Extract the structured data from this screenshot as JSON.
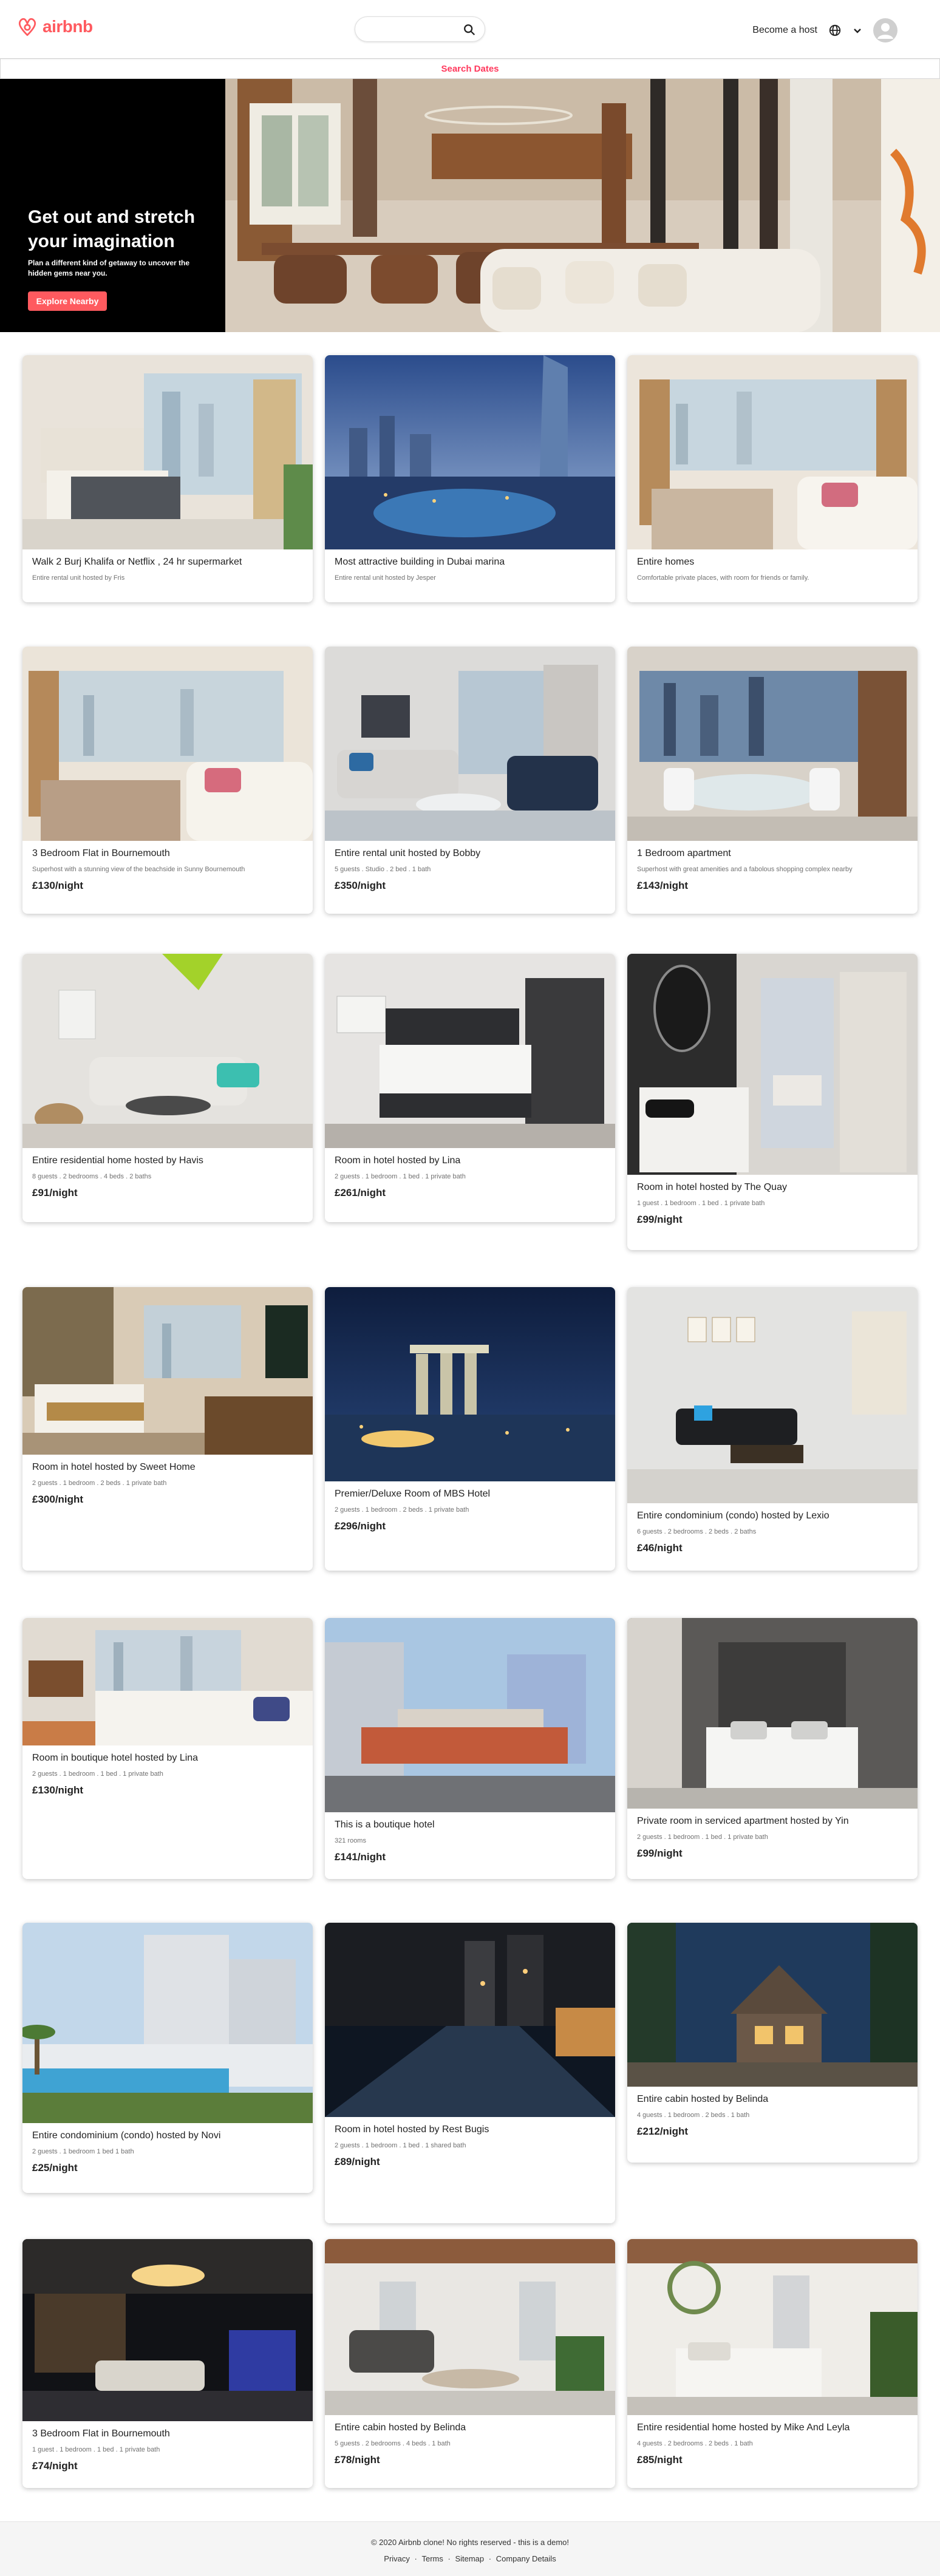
{
  "header": {
    "logo_text": "airbnb",
    "search_placeholder": "",
    "become_host": "Become a host",
    "icons": [
      "airbnb-logo-icon",
      "search-icon",
      "globe-icon",
      "chevron-down-icon",
      "user-avatar-icon"
    ]
  },
  "search_dates": "Search Dates",
  "banner": {
    "title": "Get out and stretch your imagination",
    "subtitle": "Plan a different kind of getaway to uncover the hidden gems near you.",
    "cta": "Explore Nearby"
  },
  "colors": {
    "brand": "#ff5a5f",
    "dates": "#ff385c"
  },
  "listings": [
    {
      "title": "Walk 2 Burj Khalifa or Netflix , 24 hr supermarket",
      "desc": "Entire rental unit hosted by Fris",
      "price": "",
      "photo": "bedroom-city"
    },
    {
      "title": "Most attractive building in Dubai marina",
      "desc": "Entire rental unit hosted by Jesper",
      "price": "",
      "photo": "marina-night"
    },
    {
      "title": "Entire homes",
      "desc": "Comfortable private places, with room for friends or family.",
      "price": "",
      "photo": "living-window"
    },
    {
      "title": "3 Bedroom Flat in Bournemouth",
      "desc": "Superhost with a stunning view of the beachside in Sunny Bournemouth",
      "price": "£130/night",
      "photo": "living-window"
    },
    {
      "title": "Entire rental unit hosted by Bobby",
      "desc": "5 guests . Studio . 2 bed . 1 bath",
      "price": "£350/night",
      "photo": "living-modern"
    },
    {
      "title": "1 Bedroom apartment",
      "desc": "Superhost with great amenities and a fabolous shopping complex nearby",
      "price": "£143/night",
      "photo": "dining-view"
    },
    {
      "title": "Entire residential home hosted by Havis",
      "desc": "8 guests . 2 bedrooms . 4 beds . 2 baths",
      "price": "£91/night",
      "photo": "lounge-green"
    },
    {
      "title": "Room in hotel hosted by Lina",
      "desc": "2 guests . 1 bedroom . 1 bed . 1 private bath",
      "price": "£261/night",
      "photo": "hotel-room"
    },
    {
      "title": "Room in hotel hosted by The Quay",
      "desc": "1 guest . 1 bedroom . 1 bed . 1 private bath",
      "price": "£99/night",
      "photo": "bathroom"
    },
    {
      "title": "Room in hotel hosted by Sweet Home",
      "desc": "2 guests . 1 bedroom . 2 beds . 1 private bath",
      "price": "£300/night",
      "photo": "hotel-suite"
    },
    {
      "title": "Premier/Deluxe Room of MBS Hotel",
      "desc": "2 guests . 1 bedroom . 2 beds . 1 private bath",
      "price": "£296/night",
      "photo": "mbs-night"
    },
    {
      "title": "Entire condominium (condo) hosted by Lexio",
      "desc": "6 guests . 2 bedrooms . 2 beds . 2 baths",
      "price": "£46/night",
      "photo": "condo-living"
    },
    {
      "title": "Room in boutique hotel hosted by Lina",
      "desc": "2 guests . 1 bedroom . 1 bed . 1 private bath",
      "price": "£130/night",
      "photo": "boutique-room"
    },
    {
      "title": "This is a boutique hotel",
      "desc": "321 rooms",
      "price": "£141/night",
      "photo": "hotel-exterior"
    },
    {
      "title": "Private room in serviced apartment hosted by Yin",
      "desc": "2 guests . 1 bedroom . 1 bed . 1 private bath",
      "price": "£99/night",
      "photo": "dark-bedroom"
    },
    {
      "title": "Entire condominium (condo) hosted by Novi",
      "desc": "2 guests . 1 bedroom 1 bed 1 bath",
      "price": "£25/night",
      "photo": "condo-pool"
    },
    {
      "title": "Room in hotel hosted by Rest Bugis",
      "desc": "2 guests . 1 bedroom . 1 bed . 1 shared bath",
      "price": "£89/night",
      "photo": "night-pool"
    },
    {
      "title": "Entire cabin hosted by Belinda",
      "desc": "4 guests . 1 bedroom . 2 beds . 1 bath",
      "price": "£212/night",
      "photo": "cabin-night"
    },
    {
      "title": "3 Bedroom Flat in Bournemouth",
      "desc": "1 guest . 1 bedroom . 1 bed . 1 private bath",
      "price": "£74/night",
      "photo": "lobby-blue"
    },
    {
      "title": "Entire cabin hosted by Belinda",
      "desc": "5 guests . 2 bedrooms . 4 beds . 1 bath",
      "price": "£78/night",
      "photo": "cabin-living"
    },
    {
      "title": "Entire residential home hosted by Mike And Leyla",
      "desc": "4 guests . 2 bedrooms . 2 beds . 1 bath",
      "price": "£85/night",
      "photo": "white-bedroom"
    }
  ],
  "footer": {
    "copyright": "© 2020 Airbnb clone! No rights reserved - this is a demo!",
    "links": [
      "Privacy",
      "Terms",
      "Sitemap",
      "Company Details"
    ],
    "separator": " · "
  }
}
